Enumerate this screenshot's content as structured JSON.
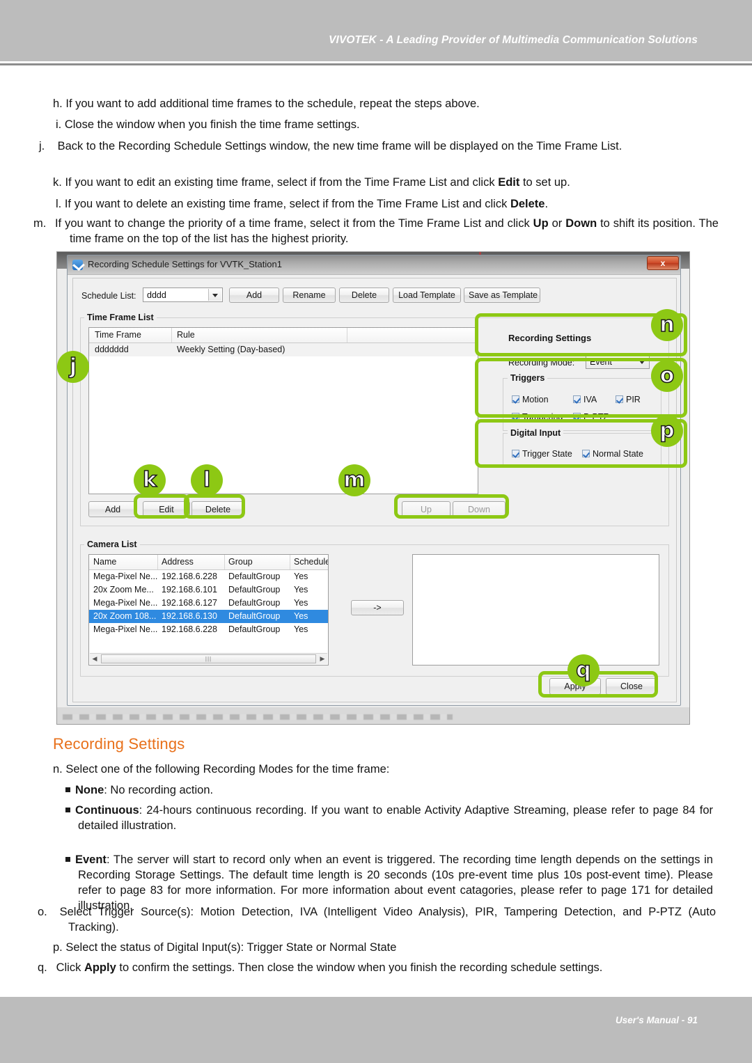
{
  "header": {
    "text": "VIVOTEK - A Leading Provider of Multimedia Communication Solutions"
  },
  "footer": {
    "text": "User's Manual - 91"
  },
  "steps": [
    {
      "label": "h.",
      "text": "If you want to add additional time frames to the schedule, repeat the steps above."
    },
    {
      "label": "i.",
      "text": "Close the window when you finish the time frame settings."
    },
    {
      "label": "j.",
      "text": "Back to the Recording Schedule Settings window, the new time frame will be displayed on the Time Frame List."
    },
    {
      "label": "k.",
      "text_a": "If you want to edit an existing time frame, select if from the Time Frame List and click ",
      "bold": "Edit",
      "text_b": " to set up."
    },
    {
      "label": "l.",
      "text_a": "If you want to delete an existing time frame, select if from the Time Frame List and click ",
      "bold": "Delete",
      "text_b": "."
    },
    {
      "label": "m.",
      "text_a": "If you want to change the priority of a time frame, select it from the Time Frame List and click ",
      "bold": "Up",
      "text_b": " or ",
      "bold2": "Down",
      "text_c": " to shift its position. The time frame on the top of the list has the highest priority."
    }
  ],
  "section": {
    "title": "Recording Settings",
    "intro_label": "n.",
    "intro": "Select one of the following Recording Modes for the time frame:",
    "modes": [
      {
        "name": "None",
        "desc": ": No recording action."
      },
      {
        "name": "Continuous",
        "desc": ": 24-hours continuous recording. If you want to enable Activity Adaptive Streaming, please refer to page 84 for detailed illustration."
      },
      {
        "name": "Event",
        "desc": ": The server will start to record only when an event is triggered. The recording time length depends on the settings in Recording Storage Settings. The default time length is 20 seconds (10s pre-event time plus 10s post-event time). Please refer to page 83 for more information. For more information about event catagories, please refer to page 171 for detailed illustration."
      }
    ],
    "after": [
      {
        "label": "o.",
        "text": "Select Trigger Source(s): Motion Detection, IVA (Intelligent Video Analysis), PIR, Tampering Detection, and P-PTZ (Auto Tracking)."
      },
      {
        "label": "p.",
        "text": "Select the status of Digital Input(s): Trigger State or Normal State"
      },
      {
        "label": "q.",
        "text_a": "Click ",
        "bold": "Apply",
        "text_b": " to confirm the settings. Then close the window when you finish the recording schedule settings."
      }
    ]
  },
  "dialog": {
    "title": "Recording Schedule Settings for VVTK_Station1",
    "close_label": "x",
    "schedule_list_label": "Schedule List:",
    "schedule_list_value": "dddd",
    "toolbar": [
      {
        "label": "Add"
      },
      {
        "label": "Rename"
      },
      {
        "label": "Delete"
      },
      {
        "label": "Load Template"
      },
      {
        "label": "Save as Template"
      }
    ],
    "time_frame_list": {
      "group_label": "Time Frame List",
      "columns": [
        "Time Frame",
        "Rule",
        ""
      ],
      "rows": [
        {
          "time_frame": "ddddddd",
          "rule": "Weekly Setting (Day-based)"
        }
      ],
      "buttons": [
        {
          "label": "Add",
          "disabled": false
        },
        {
          "label": "Edit",
          "disabled": false
        },
        {
          "label": "Delete",
          "disabled": false
        },
        {
          "label": "Up",
          "disabled": true
        },
        {
          "label": "Down",
          "disabled": true
        }
      ]
    },
    "recording_settings": {
      "title": "Recording Settings",
      "mode_label": "Recording Mode:",
      "mode_value": "Event"
    },
    "triggers": {
      "title": "Triggers",
      "items": [
        {
          "label": "Motion",
          "checked": true
        },
        {
          "label": "IVA",
          "checked": true
        },
        {
          "label": "PIR",
          "checked": true
        },
        {
          "label": "Tampering",
          "checked": true
        },
        {
          "label": "P-PTZ",
          "checked": true
        }
      ]
    },
    "digital_input": {
      "title": "Digital Input",
      "items": [
        {
          "label": "Trigger State",
          "checked": true
        },
        {
          "label": "Normal State",
          "checked": true
        }
      ]
    },
    "camera_list": {
      "group_label": "Camera List",
      "columns": [
        "Name",
        "Address",
        "Group",
        "Schedule"
      ],
      "rows": [
        {
          "name": "Mega-Pixel Ne...",
          "address": "192.168.6.228",
          "group": "DefaultGroup",
          "schedule": "Yes",
          "selected": false
        },
        {
          "name": "20x Zoom Me...",
          "address": "192.168.6.101",
          "group": "DefaultGroup",
          "schedule": "Yes",
          "selected": false
        },
        {
          "name": "Mega-Pixel Ne...",
          "address": "192.168.6.127",
          "group": "DefaultGroup",
          "schedule": "Yes",
          "selected": false
        },
        {
          "name": "20x Zoom 108...",
          "address": "192.168.6.130",
          "group": "DefaultGroup",
          "schedule": "Yes",
          "selected": true
        },
        {
          "name": "Mega-Pixel Ne...",
          "address": "192.168.6.228",
          "group": "DefaultGroup",
          "schedule": "Yes",
          "selected": false
        }
      ],
      "move_button": "->",
      "scroll_left": "◀",
      "scroll_right": "▶",
      "scroll_grip": "|||"
    },
    "footer_buttons": [
      {
        "label": "Apply"
      },
      {
        "label": "Close"
      }
    ]
  },
  "callouts": [
    {
      "id": "j",
      "letter": "j"
    },
    {
      "id": "k",
      "letter": "k"
    },
    {
      "id": "l",
      "letter": "l"
    },
    {
      "id": "m",
      "letter": "m"
    },
    {
      "id": "n",
      "letter": "n"
    },
    {
      "id": "o",
      "letter": "o"
    },
    {
      "id": "p",
      "letter": "p"
    },
    {
      "id": "q",
      "letter": "q"
    }
  ],
  "colors": {
    "accent_green": "#8dc814",
    "heading_orange": "#e8701a",
    "selection_blue": "#2f8ae0",
    "chrome_gray": "#bcbcbc"
  }
}
